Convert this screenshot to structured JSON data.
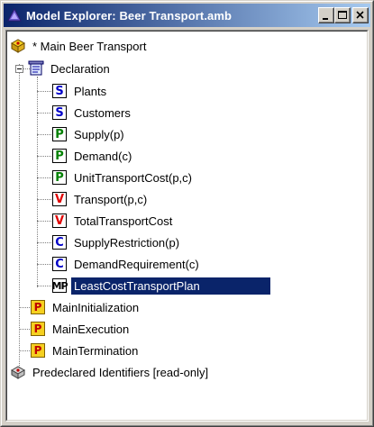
{
  "window": {
    "title": "Model Explorer: Beer Transport.amb"
  },
  "tree": {
    "root": "* Main Beer Transport",
    "declaration": {
      "label": "Declaration",
      "items": [
        {
          "icon": "set-icon",
          "letter": "S",
          "label": "Plants"
        },
        {
          "icon": "set-icon",
          "letter": "S",
          "label": "Customers"
        },
        {
          "icon": "parameter-icon",
          "letter": "P",
          "label": "Supply(p)"
        },
        {
          "icon": "parameter-icon",
          "letter": "P",
          "label": "Demand(c)"
        },
        {
          "icon": "parameter-icon",
          "letter": "P",
          "label": "UnitTransportCost(p,c)"
        },
        {
          "icon": "variable-icon",
          "letter": "V",
          "label": "Transport(p,c)"
        },
        {
          "icon": "variable-icon",
          "letter": "V",
          "label": "TotalTransportCost"
        },
        {
          "icon": "constraint-icon",
          "letter": "C",
          "label": "SupplyRestriction(p)"
        },
        {
          "icon": "constraint-icon",
          "letter": "C",
          "label": "DemandRequirement(c)"
        },
        {
          "icon": "math-program-icon",
          "letter": "MP",
          "label": "LeastCostTransportPlan",
          "selected": true
        }
      ]
    },
    "procedures": [
      {
        "label": "MainInitialization",
        "letter": "P"
      },
      {
        "label": "MainExecution",
        "letter": "P"
      },
      {
        "label": "MainTermination",
        "letter": "P"
      }
    ],
    "predeclared": "Predeclared Identifiers [read-only]"
  },
  "colors": {
    "title_gradient_start": "#0a246a",
    "title_gradient_end": "#a6caf0",
    "selection": "#0a246a"
  }
}
